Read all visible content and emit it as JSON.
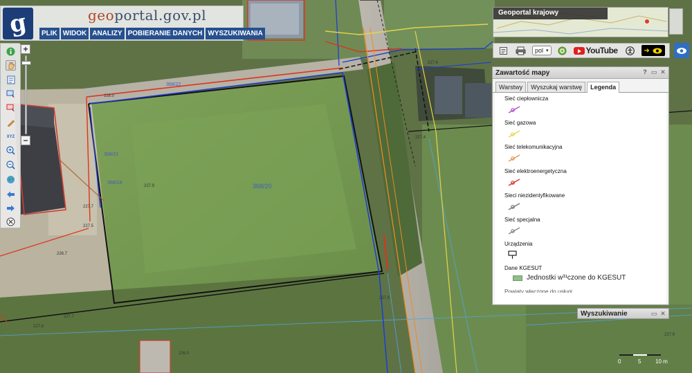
{
  "header": {
    "site_name_prefix": "geo",
    "site_name_main": "portal.gov.pl",
    "logo_letter": "g",
    "menu": [
      "PLIK",
      "WIDOK",
      "ANALIZY",
      "POBIERANIE DANYCH",
      "WYSZUKIWANIA"
    ]
  },
  "overview": {
    "title": "Geoportal krajowy"
  },
  "iconbar": {
    "language": "pol",
    "youtube": "YouTube",
    "accessibility_symbol": "➜"
  },
  "panel": {
    "title": "Zawartość mapy",
    "help": "?",
    "tabs": [
      "Warstwy",
      "Wyszukaj warstwę",
      "Legenda"
    ],
    "active_tab": "Legenda",
    "legend": [
      {
        "label": "Sieć ciepłownicza",
        "color": "#b84ad0"
      },
      {
        "label": "Sieć gazowa",
        "color": "#e8d84a"
      },
      {
        "label": "Sieć telekomunikacyjna",
        "color": "#e39a52"
      },
      {
        "label": "Sieć elektroenergetyczna",
        "color": "#d8322a"
      },
      {
        "label": "Sieci niezidentyfikowane",
        "color": "#777777"
      },
      {
        "label": "Sieć specjalna",
        "color": "#888888"
      },
      {
        "label": "Urządzenia",
        "color": "#222222"
      }
    ],
    "kgesut_title": "Dane KGESUT",
    "kgesut_item": "Jednostki w³¹czone do KGESUT",
    "truncated_line": "Powiaty włączone do usługi"
  },
  "search": {
    "title": "Wyszukiwanie"
  },
  "map": {
    "parcel_number": "368/20",
    "parcel_labels": [
      "368/20",
      "368/22",
      "368/21",
      "368/18"
    ],
    "elevation_labels": [
      "228.0",
      "227.6",
      "227.9",
      "227.6",
      "227.7",
      "227.5",
      "227.7",
      "226.7",
      "227.6",
      "227.8",
      "226.0",
      "227.4",
      "227.9"
    ]
  },
  "scale": {
    "labels": [
      "0",
      "5",
      "10 m"
    ]
  }
}
